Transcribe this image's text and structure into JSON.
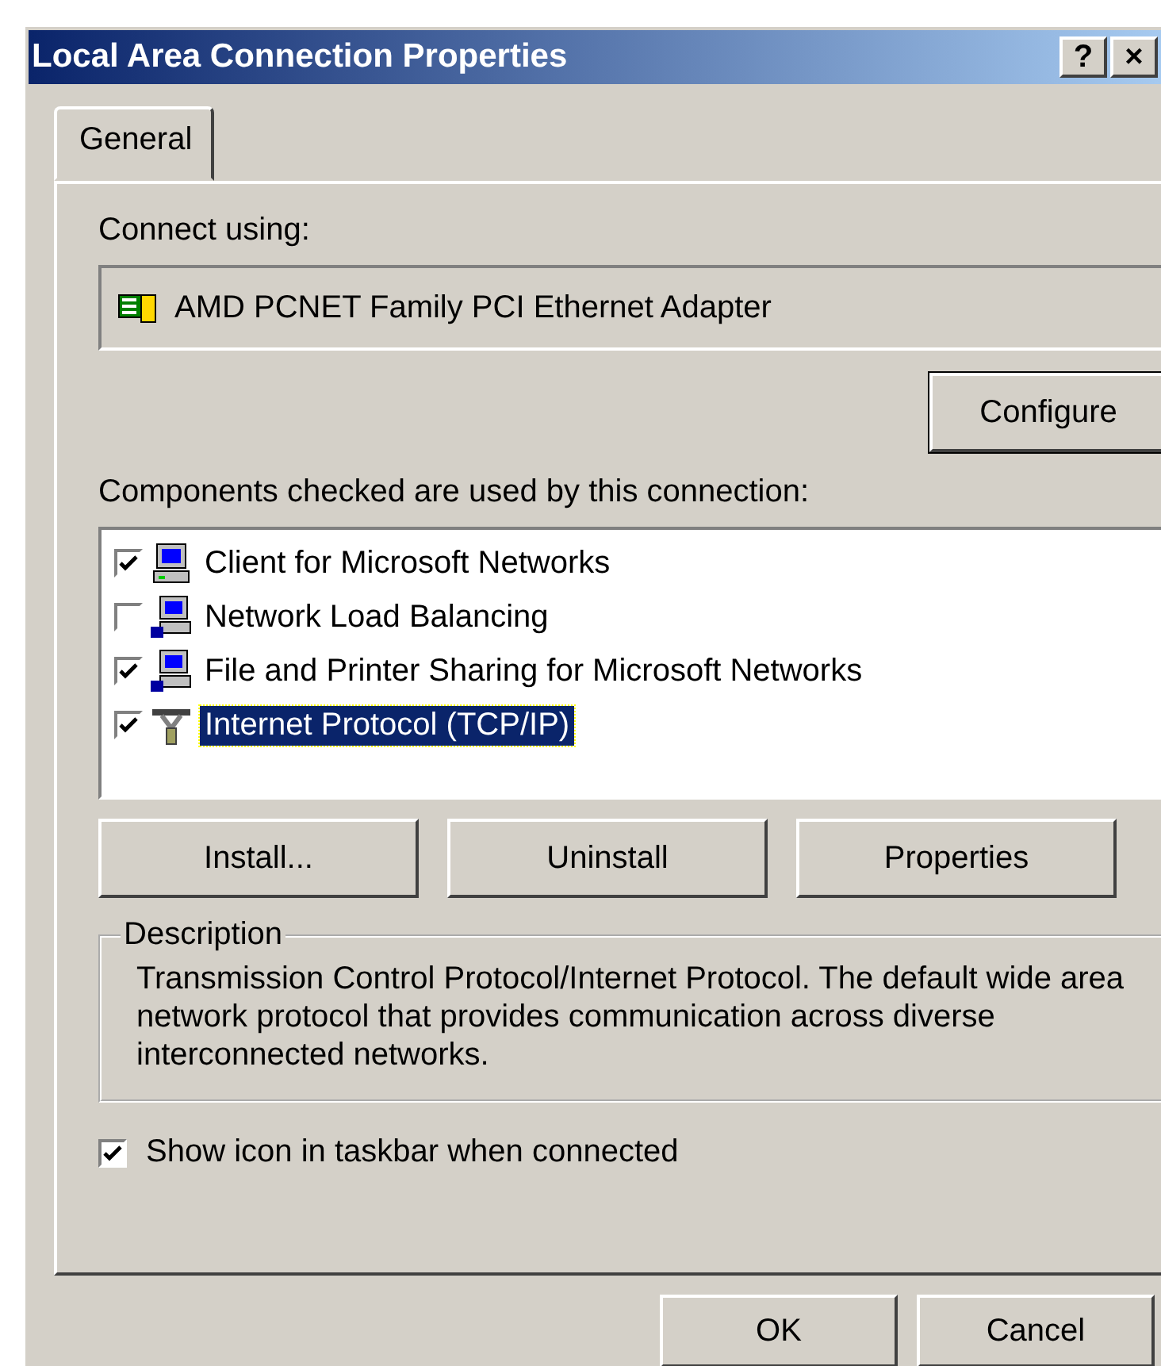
{
  "window": {
    "title": "Local Area Connection Properties",
    "title_buttons": [
      "?",
      "×"
    ]
  },
  "tabs": [
    {
      "label": "General",
      "selected": true
    }
  ],
  "connect_using": {
    "label": "Connect using:",
    "adapter": "AMD PCNET Family PCI Ethernet Adapter",
    "configure_button": "Configure"
  },
  "components": {
    "label": "Components checked are used by this connection:",
    "items": [
      {
        "kind": "computer",
        "label": "Client for Microsoft Networks",
        "checked": true,
        "selected": false
      },
      {
        "kind": "service",
        "label": "Network Load Balancing",
        "checked": false,
        "selected": false
      },
      {
        "kind": "service",
        "label": "File and Printer Sharing for Microsoft Networks",
        "checked": true,
        "selected": false
      },
      {
        "kind": "protocol",
        "label": "Internet Protocol (TCP/IP)",
        "checked": true,
        "selected": true
      }
    ]
  },
  "component_buttons": [
    "Install...",
    "Uninstall",
    "Properties"
  ],
  "description": {
    "title": "Description",
    "text": "Transmission Control Protocol/Internet Protocol. The default wide area network protocol that provides communication across diverse interconnected networks."
  },
  "show_icon": {
    "label": "Show icon in taskbar when connected",
    "checked": true
  },
  "buttons": [
    "OK",
    "Cancel"
  ]
}
